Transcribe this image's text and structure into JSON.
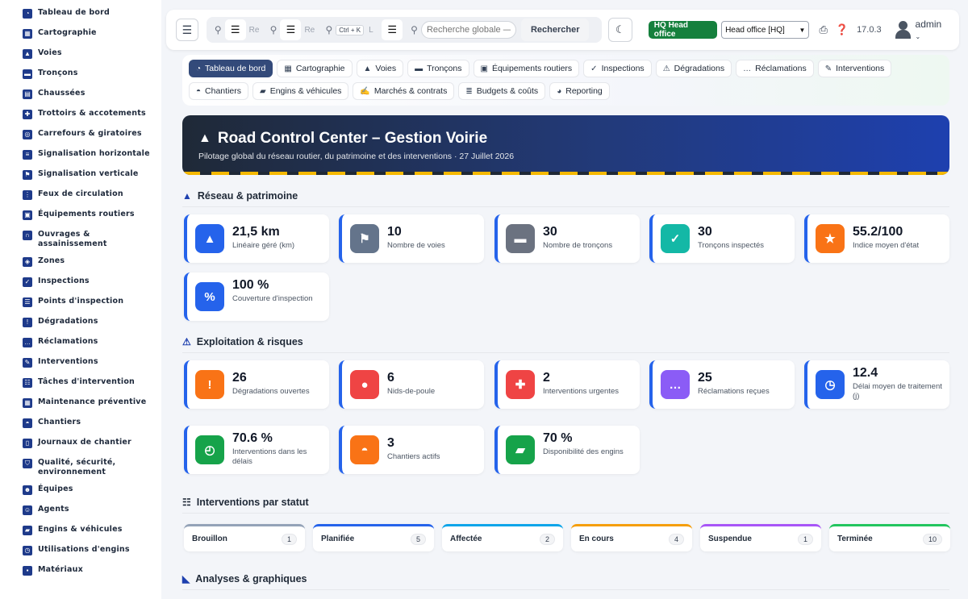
{
  "sidebar": {
    "items": [
      {
        "label": "Tableau de bord",
        "icon": "gauge-icon",
        "glyph": "◔"
      },
      {
        "label": "Cartographie",
        "icon": "map-icon",
        "glyph": "▦"
      },
      {
        "label": "Voies",
        "icon": "road-icon",
        "glyph": "▲"
      },
      {
        "label": "Tronçons",
        "icon": "ruler-icon",
        "glyph": "▬"
      },
      {
        "label": "Chaussées",
        "icon": "road-layer-icon",
        "glyph": "▤"
      },
      {
        "label": "Trottoirs & accotements",
        "icon": "walking-icon",
        "glyph": "✚"
      },
      {
        "label": "Carrefours & giratoires",
        "icon": "roundabout-icon",
        "glyph": "◎"
      },
      {
        "label": "Signalisation horizontale",
        "icon": "marking-icon",
        "glyph": "≡"
      },
      {
        "label": "Signalisation verticale",
        "icon": "sign-icon",
        "glyph": "⚑"
      },
      {
        "label": "Feux de circulation",
        "icon": "traffic-light-icon",
        "glyph": "⋮"
      },
      {
        "label": "Équipements routiers",
        "icon": "equipment-icon",
        "glyph": "▣"
      },
      {
        "label": "Ouvrages & assainissement",
        "icon": "bridge-icon",
        "glyph": "∩"
      },
      {
        "label": "Zones",
        "icon": "zones-icon",
        "glyph": "◈"
      },
      {
        "label": "Inspections",
        "icon": "clipboard-icon",
        "glyph": "✓"
      },
      {
        "label": "Points d'inspection",
        "icon": "list-icon",
        "glyph": "☰"
      },
      {
        "label": "Dégradations",
        "icon": "warning-icon",
        "glyph": "!"
      },
      {
        "label": "Réclamations",
        "icon": "comment-icon",
        "glyph": "…"
      },
      {
        "label": "Interventions",
        "icon": "wrench-icon",
        "glyph": "✎"
      },
      {
        "label": "Tâches d'intervention",
        "icon": "tasks-icon",
        "glyph": "☷"
      },
      {
        "label": "Maintenance préventive",
        "icon": "calendar-icon",
        "glyph": "▦"
      },
      {
        "label": "Chantiers",
        "icon": "hardhat-icon",
        "glyph": "◓"
      },
      {
        "label": "Journaux de chantier",
        "icon": "book-icon",
        "glyph": "▯"
      },
      {
        "label": "Qualité, sécurité, environnement",
        "icon": "shield-icon",
        "glyph": "⛉"
      },
      {
        "label": "Équipes",
        "icon": "team-icon",
        "glyph": "☻"
      },
      {
        "label": "Agents",
        "icon": "user-icon",
        "glyph": "☺"
      },
      {
        "label": "Engins & véhicules",
        "icon": "truck-icon",
        "glyph": "▰"
      },
      {
        "label": "Utilisations d'engins",
        "icon": "clock-icon",
        "glyph": "◷"
      },
      {
        "label": "Matériaux",
        "icon": "box-icon",
        "glyph": "▪"
      }
    ]
  },
  "topbar": {
    "search_fragment_1": "Re",
    "search_fragment_2": "Re",
    "kbd": "Ctrl + K",
    "kbd_fragment": "L",
    "search_placeholder": "Recherche globale — c",
    "search_button": "Rechercher",
    "hq_badge": "HQ Head office",
    "hq_select": "Head office [HQ]",
    "version": "17.0.3",
    "user": "admin"
  },
  "nav": {
    "row1": [
      {
        "label": "Tableau de bord",
        "glyph": "◔",
        "icon": "gauge-icon",
        "active": true
      },
      {
        "label": "Cartographie",
        "glyph": "▦",
        "icon": "map-icon"
      },
      {
        "label": "Voies",
        "glyph": "▲",
        "icon": "road-icon"
      },
      {
        "label": "Tronçons",
        "glyph": "▬",
        "icon": "ruler-icon"
      },
      {
        "label": "Équipements routiers",
        "glyph": "▣",
        "icon": "equipment-icon"
      },
      {
        "label": "Inspections",
        "glyph": "✓",
        "icon": "clipboard-icon"
      },
      {
        "label": "Dégradations",
        "glyph": "⚠",
        "icon": "warning-icon"
      },
      {
        "label": "Réclamations",
        "glyph": "…",
        "icon": "comment-icon"
      },
      {
        "label": "Interventions",
        "glyph": "✎",
        "icon": "wrench-icon"
      }
    ],
    "row2": [
      {
        "label": "Chantiers",
        "glyph": "◓",
        "icon": "hardhat-icon"
      },
      {
        "label": "Engins & véhicules",
        "glyph": "▰",
        "icon": "truck-icon"
      },
      {
        "label": "Marchés & contrats",
        "glyph": "✍",
        "icon": "contract-icon"
      },
      {
        "label": "Budgets & coûts",
        "glyph": "≣",
        "icon": "coins-icon"
      },
      {
        "label": "Reporting",
        "glyph": "◕",
        "icon": "pie-icon"
      }
    ]
  },
  "hero": {
    "title": "Road Control Center – Gestion Voirie",
    "subtitle": "Pilotage global du réseau routier, du patrimoine et des interventions · 27 Juillet 2026"
  },
  "sections": {
    "reseau": "Réseau & patrimoine",
    "exploitation": "Exploitation & risques",
    "statut": "Interventions par statut",
    "analyses": "Analyses & graphiques"
  },
  "kpi_reseau": [
    {
      "value": "21,5 km",
      "label": "Linéaire géré (km)",
      "color": "#2563eb",
      "glyph": "▲",
      "icon": "road-icon"
    },
    {
      "value": "10",
      "label": "Nombre de voies",
      "color": "#64748b",
      "glyph": "⚑",
      "icon": "signpost-icon"
    },
    {
      "value": "30",
      "label": "Nombre de tronçons",
      "color": "#6b7280",
      "glyph": "▬",
      "icon": "ruler-icon"
    },
    {
      "value": "30",
      "label": "Tronçons inspectés",
      "color": "#14b8a6",
      "glyph": "✓",
      "icon": "clipboard-check-icon"
    },
    {
      "value": "55.2/100",
      "label": "Indice moyen d'état",
      "color": "#f97316",
      "glyph": "★",
      "icon": "star-icon"
    },
    {
      "value": "100 %",
      "label": "Couverture d'inspection",
      "color": "#2563eb",
      "glyph": "%",
      "icon": "percent-icon"
    }
  ],
  "kpi_exploitation": [
    {
      "value": "26",
      "label": "Dégradations ouvertes",
      "color": "#f97316",
      "glyph": "!",
      "icon": "warning-icon"
    },
    {
      "value": "6",
      "label": "Nids-de-poule",
      "color": "#ef4444",
      "glyph": "●",
      "icon": "pothole-icon"
    },
    {
      "value": "2",
      "label": "Interventions urgentes",
      "color": "#ef4444",
      "glyph": "✚",
      "icon": "ambulance-icon"
    },
    {
      "value": "25",
      "label": "Réclamations reçues",
      "color": "#8b5cf6",
      "glyph": "…",
      "icon": "comment-icon"
    },
    {
      "value": "12.4",
      "label": "Délai moyen de traitement (j)",
      "color": "#2563eb",
      "glyph": "◷",
      "icon": "clock-icon"
    },
    {
      "value": "70.6 %",
      "label": "Interventions dans les délais",
      "color": "#16a34a",
      "glyph": "◴",
      "icon": "stopwatch-icon"
    },
    {
      "value": "3",
      "label": "Chantiers actifs",
      "color": "#f97316",
      "glyph": "◓",
      "icon": "hardhat-icon"
    },
    {
      "value": "70 %",
      "label": "Disponibilité des engins",
      "color": "#16a34a",
      "glyph": "▰",
      "icon": "truck-icon"
    }
  ],
  "statuses": [
    {
      "label": "Brouillon",
      "count": "1",
      "color": "#94a3b8"
    },
    {
      "label": "Planifiée",
      "count": "5",
      "color": "#2563eb"
    },
    {
      "label": "Affectée",
      "count": "2",
      "color": "#0ea5e9"
    },
    {
      "label": "En cours",
      "count": "4",
      "color": "#f59e0b"
    },
    {
      "label": "Suspendue",
      "count": "1",
      "color": "#a855f7"
    },
    {
      "label": "Terminée",
      "count": "10",
      "color": "#22c55e"
    }
  ]
}
